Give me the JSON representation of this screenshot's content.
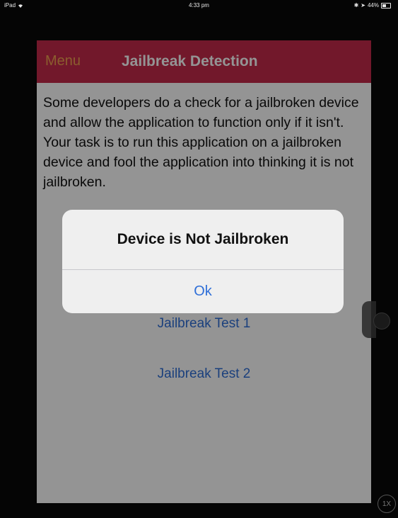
{
  "status_bar": {
    "device": "iPad",
    "time": "4:33 pm",
    "battery": "44%",
    "icons": [
      "wifi-icon",
      "bluetooth-icon",
      "location-icon",
      "battery-icon"
    ]
  },
  "nav": {
    "menu_label": "Menu",
    "title": "Jailbreak Detection"
  },
  "content": {
    "description": "Some developers do a check for a jailbroken device and allow the application to function only if it isn't. Your task is to run this application on a jailbroken device and fool the application into thinking it is not jailbroken."
  },
  "buttons": {
    "test1": "Jailbreak Test 1",
    "test2": "Jailbreak Test 2"
  },
  "alert": {
    "title": "Device is Not Jailbroken",
    "ok_label": "Ok"
  },
  "zoom": {
    "label": "1X"
  },
  "colors": {
    "nav_background": "#c42a4a",
    "menu_text": "#f0a050",
    "link_blue": "#2f6fd8"
  }
}
